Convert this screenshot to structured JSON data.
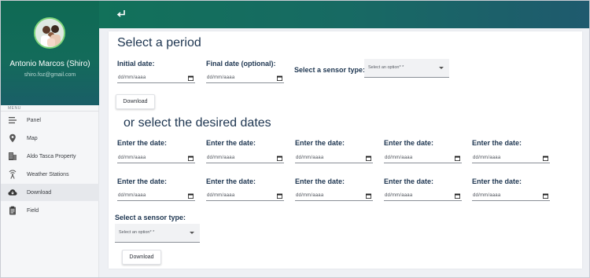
{
  "user": {
    "name": "Antonio Marcos (Shiro)",
    "email": "shiro.foz@gmail.com"
  },
  "menu": {
    "label": "MENU",
    "items": [
      {
        "label": "Panel",
        "icon": "menu-lines-icon"
      },
      {
        "label": "Map",
        "icon": "map-pin-icon"
      },
      {
        "label": "Aldo Tasca Property",
        "icon": "building-icon"
      },
      {
        "label": "Weather Stations",
        "icon": "antenna-icon"
      },
      {
        "label": "Download",
        "icon": "cloud-download-icon",
        "active": true
      },
      {
        "label": "Field",
        "icon": "clipboard-icon"
      }
    ]
  },
  "topbar": {
    "back_icon": "return-arrow-icon"
  },
  "period": {
    "title": "Select a period",
    "initial_label": "Initial date:",
    "final_label": "Final date (optional):",
    "date_placeholder": "dd/mm/aaaa",
    "sensor_label": "Select a sensor type:",
    "sensor_placeholder": "Select an option* *",
    "download_label": "Download"
  },
  "dates": {
    "title": "or select the desired dates",
    "field_label": "Enter the date:",
    "date_placeholder": "dd/mm/aaaa",
    "sensor_label": "Select a sensor type:",
    "sensor_placeholder": "Select an option* *",
    "download_label": "Download"
  },
  "colors": {
    "primary_green": "#12715a",
    "heading_navy": "#1d3550",
    "active_bg": "#e6e8ec"
  }
}
